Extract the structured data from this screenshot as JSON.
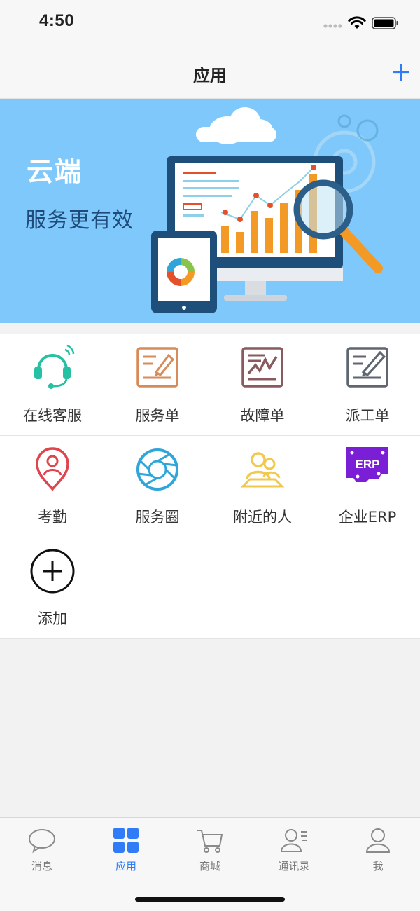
{
  "status_bar": {
    "time": "4:50"
  },
  "navbar": {
    "title": "应用"
  },
  "banner": {
    "title": "云端",
    "subtitle": "服务更有效"
  },
  "apps": [
    {
      "label": "在线客服",
      "icon": "headset-icon"
    },
    {
      "label": "服务单",
      "icon": "service-order-icon"
    },
    {
      "label": "故障单",
      "icon": "fault-order-icon"
    },
    {
      "label": "派工单",
      "icon": "dispatch-order-icon"
    },
    {
      "label": "考勤",
      "icon": "location-pin-icon"
    },
    {
      "label": "服务圈",
      "icon": "aperture-icon"
    },
    {
      "label": "附近的人",
      "icon": "people-icon"
    },
    {
      "label": "企业ERP",
      "icon": "erp-icon",
      "badge": "ERP"
    },
    {
      "label": "添加",
      "icon": "add-circle-icon"
    }
  ],
  "tabs": [
    {
      "label": "消息",
      "icon": "chat-bubble-icon"
    },
    {
      "label": "应用",
      "icon": "apps-grid-icon",
      "active": true
    },
    {
      "label": "商城",
      "icon": "cart-icon"
    },
    {
      "label": "通讯录",
      "icon": "contacts-icon"
    },
    {
      "label": "我",
      "icon": "user-icon"
    }
  ],
  "colors": {
    "accent": "#2f7cf6",
    "banner_bg": "#7ec8fb"
  }
}
